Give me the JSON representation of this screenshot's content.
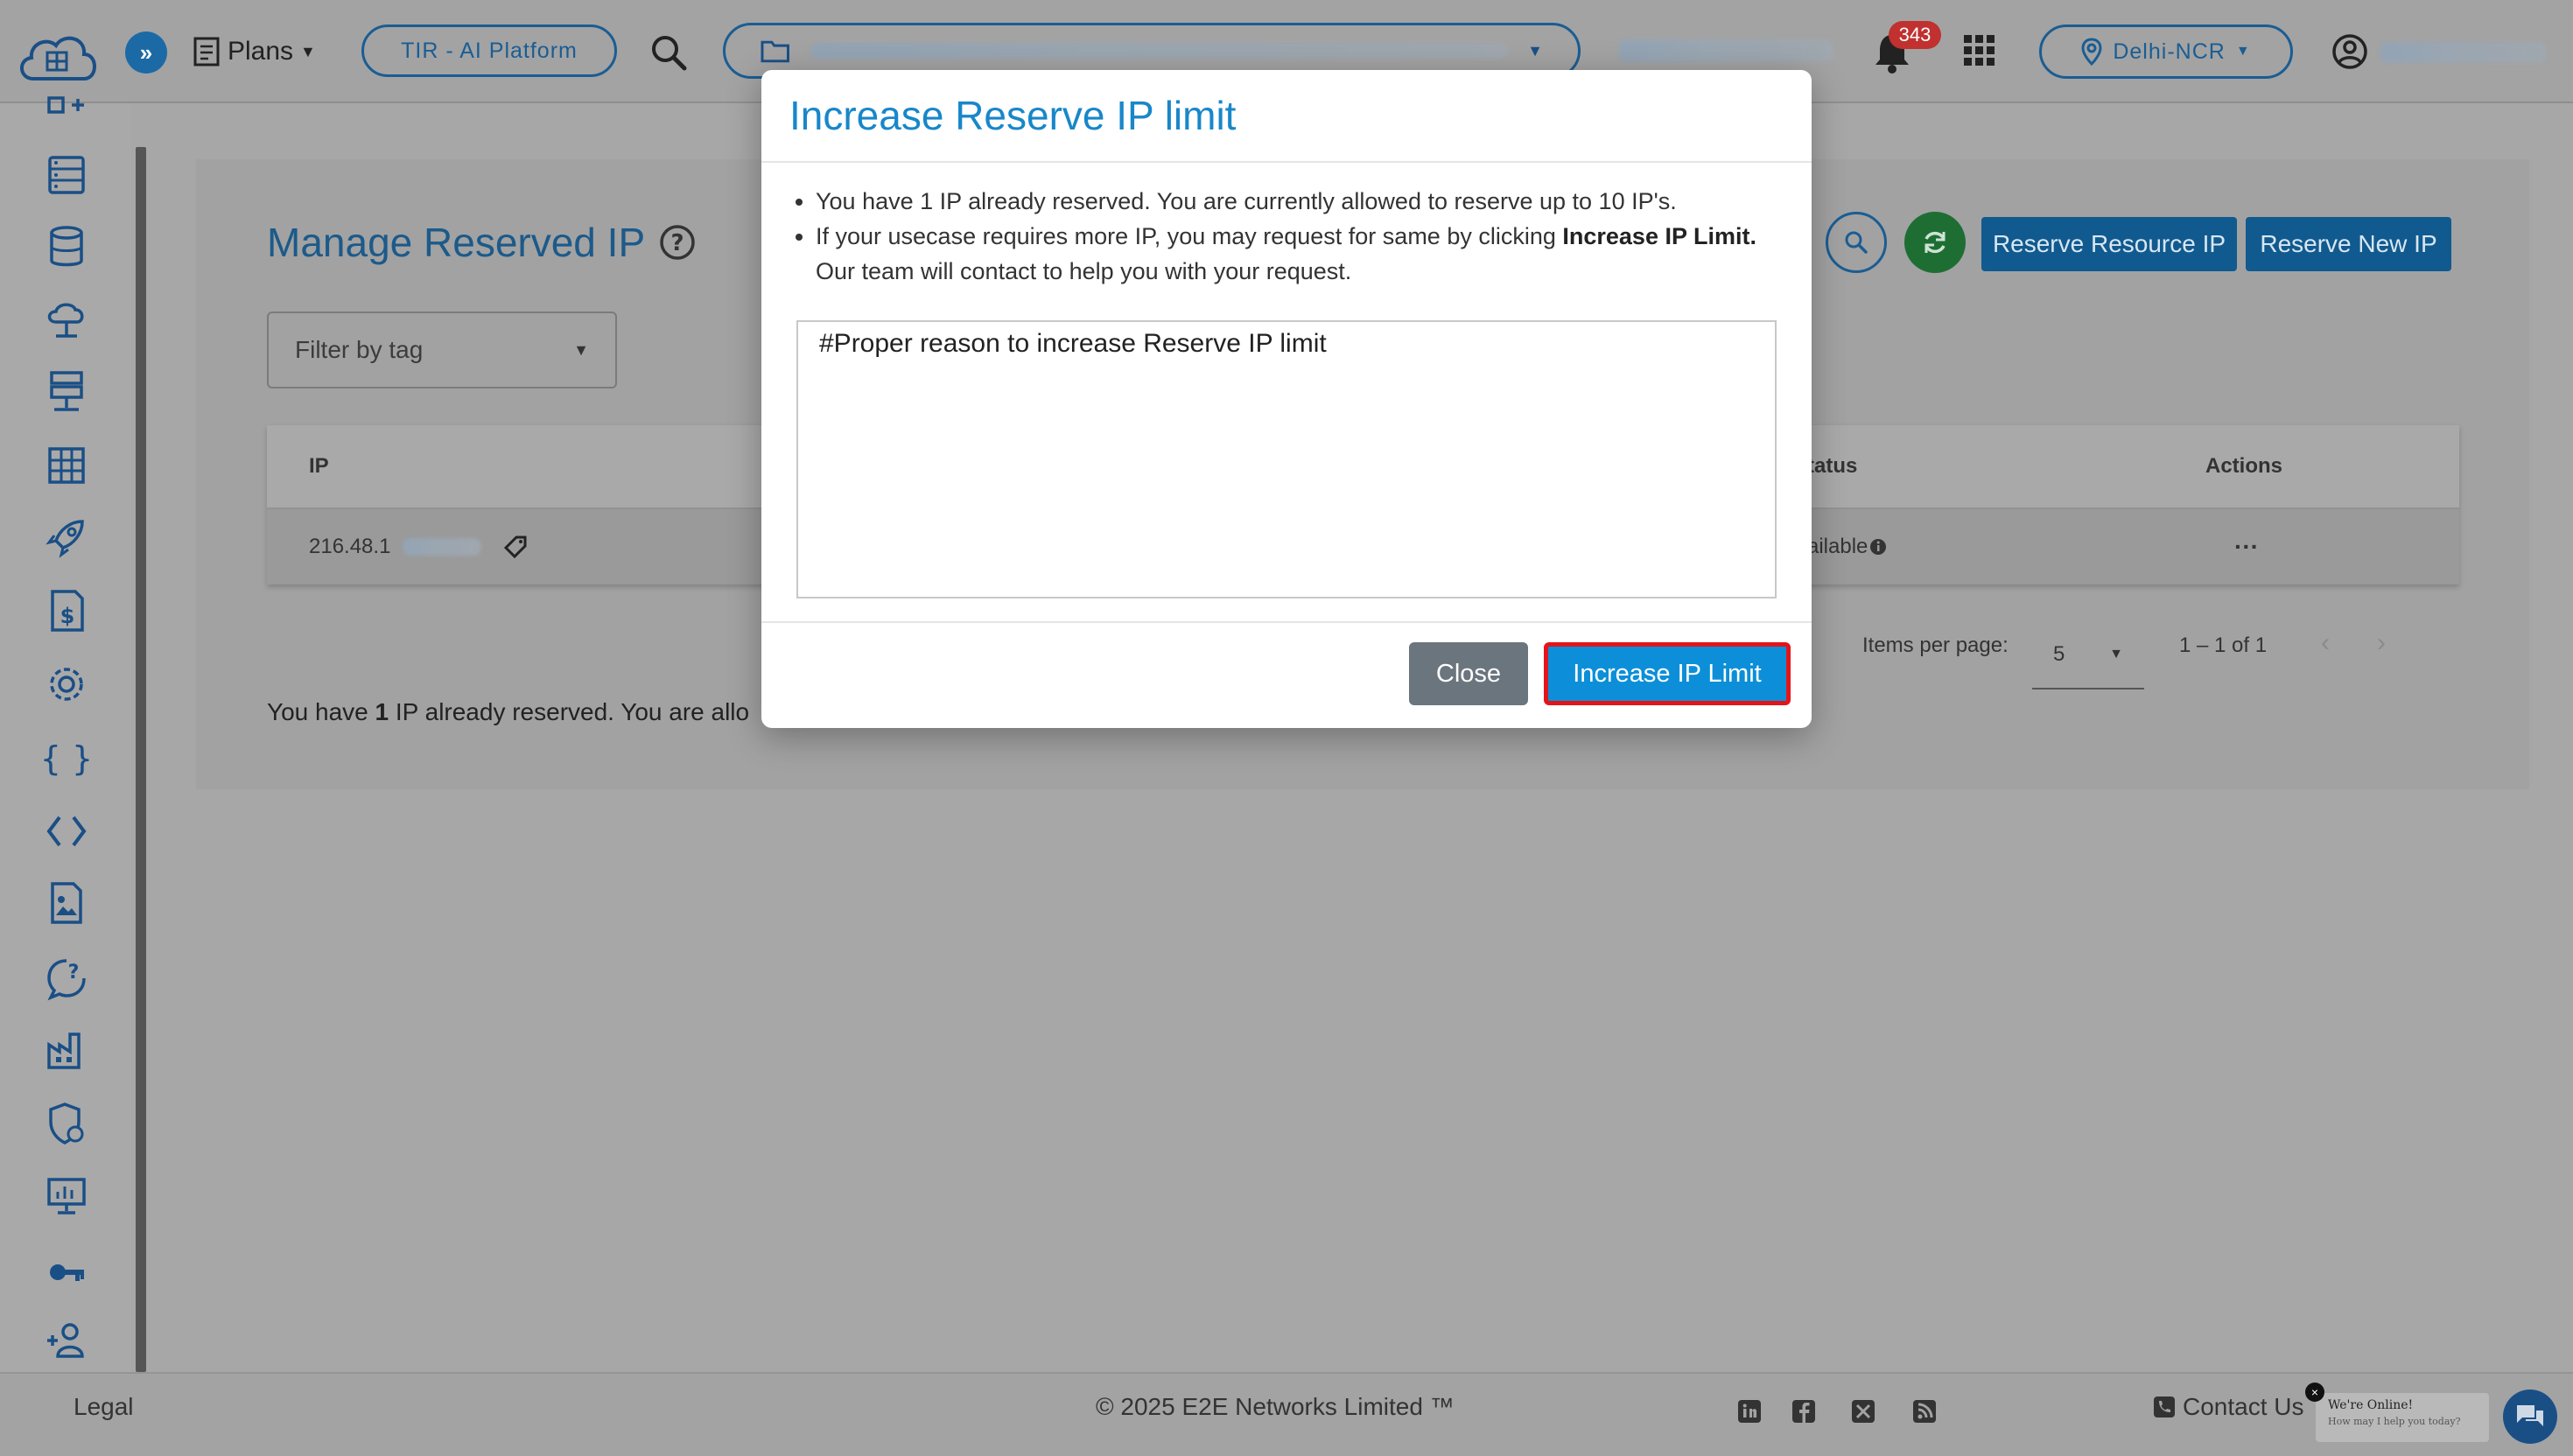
{
  "header": {
    "plans_label": "Plans",
    "tir_label": "TIR - AI Platform",
    "notification_count": "343",
    "region_label": "Delhi-NCR"
  },
  "page": {
    "title": "Manage Reserved IP",
    "filter_placeholder": "Filter by tag",
    "reserve_resource_label": "Reserve Resource IP",
    "reserve_new_label": "Reserve New IP"
  },
  "table": {
    "columns": {
      "ip": "IP",
      "status": "tatus",
      "actions": "Actions"
    },
    "rows": [
      {
        "ip": "216.48.1",
        "status": "ailable",
        "actions": "···"
      }
    ]
  },
  "paginator": {
    "items_per_page_label": "Items per page:",
    "page_size": "5",
    "range": "1 – 1 of 1"
  },
  "bottom_note": {
    "prefix": "You have ",
    "count": "1",
    "suffix": " IP already reserved. You are allo"
  },
  "modal": {
    "title": "Increase Reserve IP limit",
    "bullet1": "You have 1 IP already reserved. You are currently allowed to reserve up to 10 IP's.",
    "bullet2_pre": "If your usecase requires more IP, you may request for same by clicking ",
    "bullet2_bold": "Increase IP Limit.",
    "bullet2_post": " Our team will contact to help you with your request.",
    "reason_text": "#Proper reason to increase Reserve IP limit",
    "close_label": "Close",
    "increase_label": "Increase IP Limit"
  },
  "footer": {
    "legal": "Legal",
    "copyright": "© 2025 E2E Networks Limited ™",
    "contact": "Contact Us"
  },
  "chat": {
    "line1": "We're Online!",
    "line2": "How may I help you today?"
  },
  "colors": {
    "accent": "#1887c9",
    "primary_dark": "#115a8f",
    "highlight_border": "#e3141a",
    "badge": "#c0312f"
  }
}
